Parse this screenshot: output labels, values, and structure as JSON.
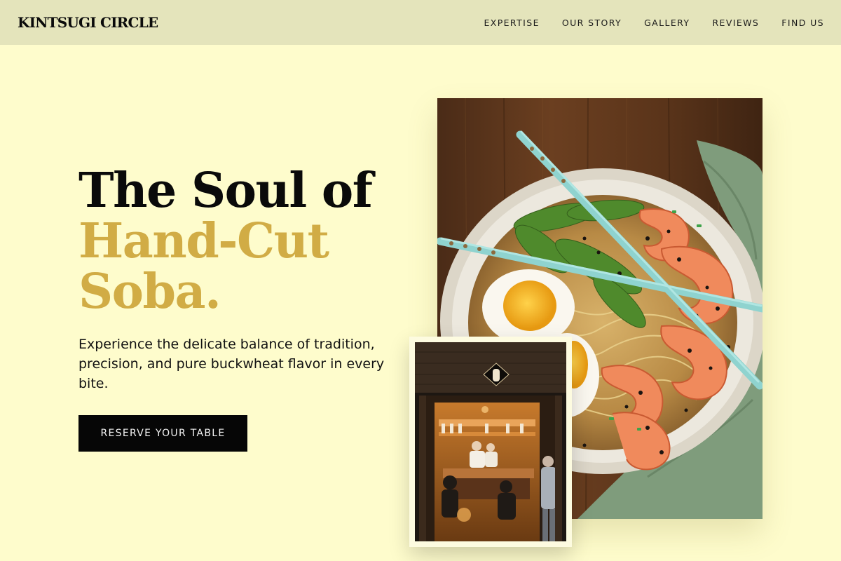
{
  "brand": {
    "name": "KINTSUGI CIRCLE"
  },
  "nav": {
    "items": [
      "EXPERTISE",
      "OUR STORY",
      "GALLERY",
      "REVIEWS",
      "FIND US"
    ]
  },
  "hero": {
    "line1": "The Soul of",
    "line2": "Hand-Cut",
    "line3": "Soba.",
    "description": "Experience the delicate balance of tradition, precision, and pure buckwheat flavor in every bite.",
    "cta_label": "RESERVE YOUR TABLE"
  },
  "colors": {
    "background": "#fefccc",
    "header": "#e4e4bb",
    "accent_gold": "#d1ac45",
    "button": "#060606"
  }
}
